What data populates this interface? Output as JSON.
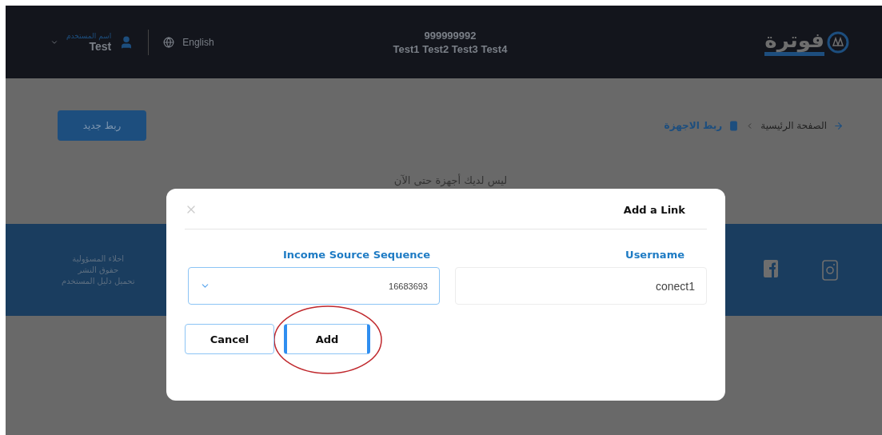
{
  "header": {
    "user_menu": {
      "label": "اسم المستخدم",
      "name": "Test"
    },
    "language": "English",
    "account": {
      "number": "999999992",
      "names": "Test1 Test2 Test3 Test4"
    },
    "logo": "فوترة"
  },
  "breadcrumb": [
    {
      "label": "الصفحة الرئيسية",
      "current": false
    },
    {
      "label": "ربط الاجهزة",
      "current": true
    }
  ],
  "new_link_button": "ربط جديد",
  "empty_message": "ليس لديك أجهزة حتى الآن",
  "footer": {
    "links": [
      "اخلاء المسؤولية",
      "حقوق النشر",
      "تحميل دليل المستخدم"
    ]
  },
  "dialog": {
    "title": "Add a Link",
    "fields": [
      {
        "kind": "text",
        "label": "Username",
        "value": "conect1",
        "focused": false
      },
      {
        "kind": "select",
        "label": "Income Source Sequence",
        "value": "16683693",
        "focused": true
      }
    ],
    "buttons": [
      {
        "label": "Add",
        "primary": true
      },
      {
        "label": "Cancel",
        "primary": false
      }
    ]
  }
}
